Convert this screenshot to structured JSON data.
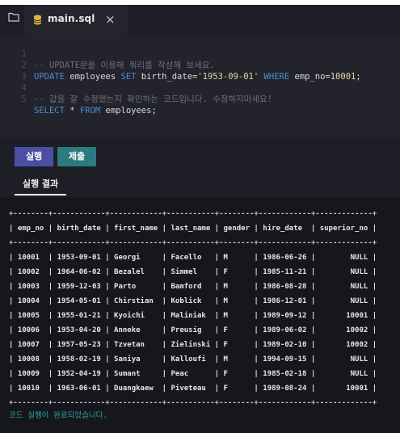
{
  "tab": {
    "filename": "main.sql",
    "close_glyph": "×"
  },
  "editor": {
    "lines": [
      {
        "no": "1",
        "text": "-- UPDATE문을 이용해 쿼리를 작성해 보세요."
      },
      {
        "no": "2",
        "text": "UPDATE employees SET birth_date='1953-09-01' WHERE emp_no=10001;"
      },
      {
        "no": "3",
        "text": ""
      },
      {
        "no": "4",
        "text": "-- 값을 잘 수정했는지 확인하는 코드입니다. 수정하지마세요!"
      },
      {
        "no": "5",
        "text": "SELECT * FROM employees;"
      }
    ]
  },
  "toolbar": {
    "run_label": "실행",
    "submit_label": "제출"
  },
  "results": {
    "tab_label": "실행 결과",
    "border": "+--------+------------+------------+-----------+--------+------------+-------------+",
    "columns": [
      "emp_no",
      "birth_date",
      "first_name",
      "last_name",
      "gender",
      "hire_date",
      "superior_no"
    ],
    "rows": [
      [
        "10001",
        "1953-09-01",
        "Georgi",
        "Facello",
        "M",
        "1986-06-26",
        "NULL"
      ],
      [
        "10002",
        "1964-06-02",
        "Bezalel",
        "Simmel",
        "F",
        "1985-11-21",
        "NULL"
      ],
      [
        "10003",
        "1959-12-03",
        "Parto",
        "Bamford",
        "M",
        "1986-08-28",
        "NULL"
      ],
      [
        "10004",
        "1954-05-01",
        "Chirstian",
        "Koblick",
        "M",
        "1986-12-01",
        "NULL"
      ],
      [
        "10005",
        "1955-01-21",
        "Kyoichi",
        "Maliniak",
        "M",
        "1989-09-12",
        "10001"
      ],
      [
        "10006",
        "1953-04-20",
        "Anneke",
        "Preusig",
        "F",
        "1989-06-02",
        "10002"
      ],
      [
        "10007",
        "1957-05-23",
        "Tzvetan",
        "Zielinski",
        "F",
        "1989-02-10",
        "10002"
      ],
      [
        "10008",
        "1958-02-19",
        "Saniya",
        "Kalloufi",
        "M",
        "1994-09-15",
        "NULL"
      ],
      [
        "10009",
        "1952-04-19",
        "Sumant",
        "Peac",
        "F",
        "1985-02-18",
        "NULL"
      ],
      [
        "10010",
        "1963-06-01",
        "Duangkaew",
        "Piveteau",
        "F",
        "1989-08-24",
        "10001"
      ]
    ],
    "status": "코드 실행이 완료되었습니다."
  },
  "colors": {
    "background": "#1e1e26",
    "editor_bg": "#23242b",
    "output_bg": "#16161d",
    "run_button": "#4a4fa3",
    "submit_button": "#2a7c80",
    "keyword": "#4d8ad6",
    "comment": "#6b6f7c",
    "string": "#e2d6a6",
    "status": "#2aa79a"
  },
  "icons": {
    "sidebar": "folder-icon",
    "file": "database-icon",
    "close": "close-icon"
  }
}
